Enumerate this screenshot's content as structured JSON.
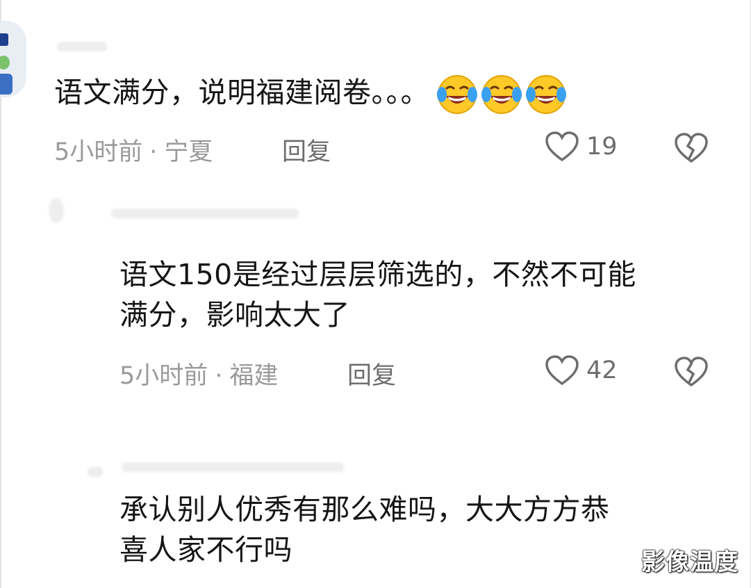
{
  "comments": [
    {
      "text": "语文满分，说明福建阅卷。。。",
      "emojis": [
        "laughing-crying-emoji",
        "laughing-crying-emoji",
        "laughing-crying-emoji"
      ],
      "time": "5小时前",
      "location": "宁夏",
      "reply_label": "回复",
      "likes": "19"
    },
    {
      "text_line1": "语文150是经过层层筛选的，不然不可能",
      "text_line2": "满分，影响太大了",
      "time": "5小时前",
      "location": "福建",
      "reply_label": "回复",
      "likes": "42"
    },
    {
      "text_line1": "承认别人优秀有那么难吗，大大方方恭",
      "text_line2": "喜人家不行吗"
    }
  ],
  "separator": "·",
  "watermark": "影像温度",
  "icons": {
    "like": "heart-outline-icon",
    "dislike": "broken-heart-icon"
  },
  "colors": {
    "text": "#151515",
    "meta": "#9a9a9a",
    "action": "#6d6d6d",
    "emoji_face": "#ffc928",
    "emoji_tear": "#3aa0f0"
  }
}
